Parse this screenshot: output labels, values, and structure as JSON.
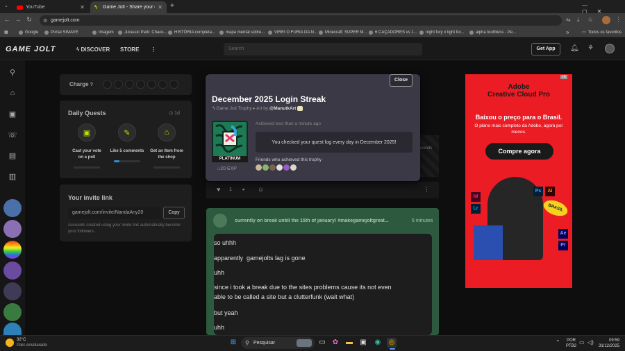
{
  "browser": {
    "tabs": [
      {
        "title": "YouTube",
        "active": false
      },
      {
        "title": "Game Jolt - Share your creations",
        "active": true
      }
    ],
    "new_tab": "+",
    "url": "gamejolt.com",
    "bookmarks": [
      "Google",
      "Portal SIMAVE",
      "Imagem",
      "Jurassic Park: Chaos...",
      "HISTÓRIA completa...",
      "mapa mental sobre...",
      "VIREI O FURIA DA N...",
      "Minecraft: SUPER M...",
      "6 CAÇADORES vs 1...",
      "night fury x light fur...",
      "alpha toothless - Pe..."
    ],
    "bookmarks_folder": "Todos os favoritos",
    "more": "»"
  },
  "site": {
    "logo": "GAME JOLT",
    "nav": [
      "DISCOVER",
      "STORE"
    ],
    "search_placeholder": "Search",
    "get_app": "Get App"
  },
  "sidebar_panels": {
    "charge_label": "Charge",
    "daily_quests_title": "Daily Quests",
    "quests_timer": "1d",
    "quests": [
      {
        "label": "Cast your vote on a poll",
        "progress": 0
      },
      {
        "label": "Like 5 comments",
        "progress": 0.2
      },
      {
        "label": "Get an Item from the shop",
        "progress": 0
      }
    ],
    "invite_title": "Your invite link",
    "invite_link": "gamejolt.com/invite/NandaAny20",
    "copy_label": "Copy",
    "invite_note": "Accounts created using your invite link automatically become your followers."
  },
  "feed": {
    "like_count": "1",
    "seconds_fragment": "econds",
    "post_header": "currently on break untill the 15th of january! #makegamejoltgreat...",
    "post_time": "5 minutes",
    "post_lines": [
      "so uhhh",
      "apparently  gamejolts lag is gone",
      "uhh",
      "since i took a break due to the sites problems cause its not even",
      "able to be called a site but a clutterfunk (wait what)",
      "but yeah",
      "uhh"
    ]
  },
  "modal": {
    "close_label": "Close",
    "title": "December 2025 Login Streak",
    "subtitle_type": "Game Jolt Trophy",
    "subtitle_art": "Art by",
    "artist": "@ManutkArt",
    "rarity": "PLATINUM",
    "exp": "20 EXP",
    "achieved": "Achieved less than a minute ago",
    "message": "You checked your quest log every day in December 2025!",
    "friends_label": "Friends who achieved this trophy"
  },
  "ad": {
    "brand": "Adobe",
    "product": "Creative Cloud Pro",
    "headline": "Baixou o preço para o Brasil.",
    "sub": "O plano mais completo da Adobe, agora por menos.",
    "cta": "Compre agora",
    "ad_badge": "i X",
    "app_badges": [
      "Ps",
      "Ai",
      "Id",
      "Lr",
      "Ae",
      "Pr"
    ],
    "sticker": "BRASIL"
  },
  "taskbar": {
    "weather_temp": "32°C",
    "weather_desc": "Parc ensolarado",
    "search": "Pesquisar",
    "lang1": "POR",
    "lang2": "PTB2",
    "time": "09:59",
    "date": "31/12/2025"
  },
  "colors": {
    "accent": "#ccff00",
    "ad_red": "#ec1c24",
    "post_green": "#2d5a3f",
    "trophy_green": "#1e7a55"
  }
}
